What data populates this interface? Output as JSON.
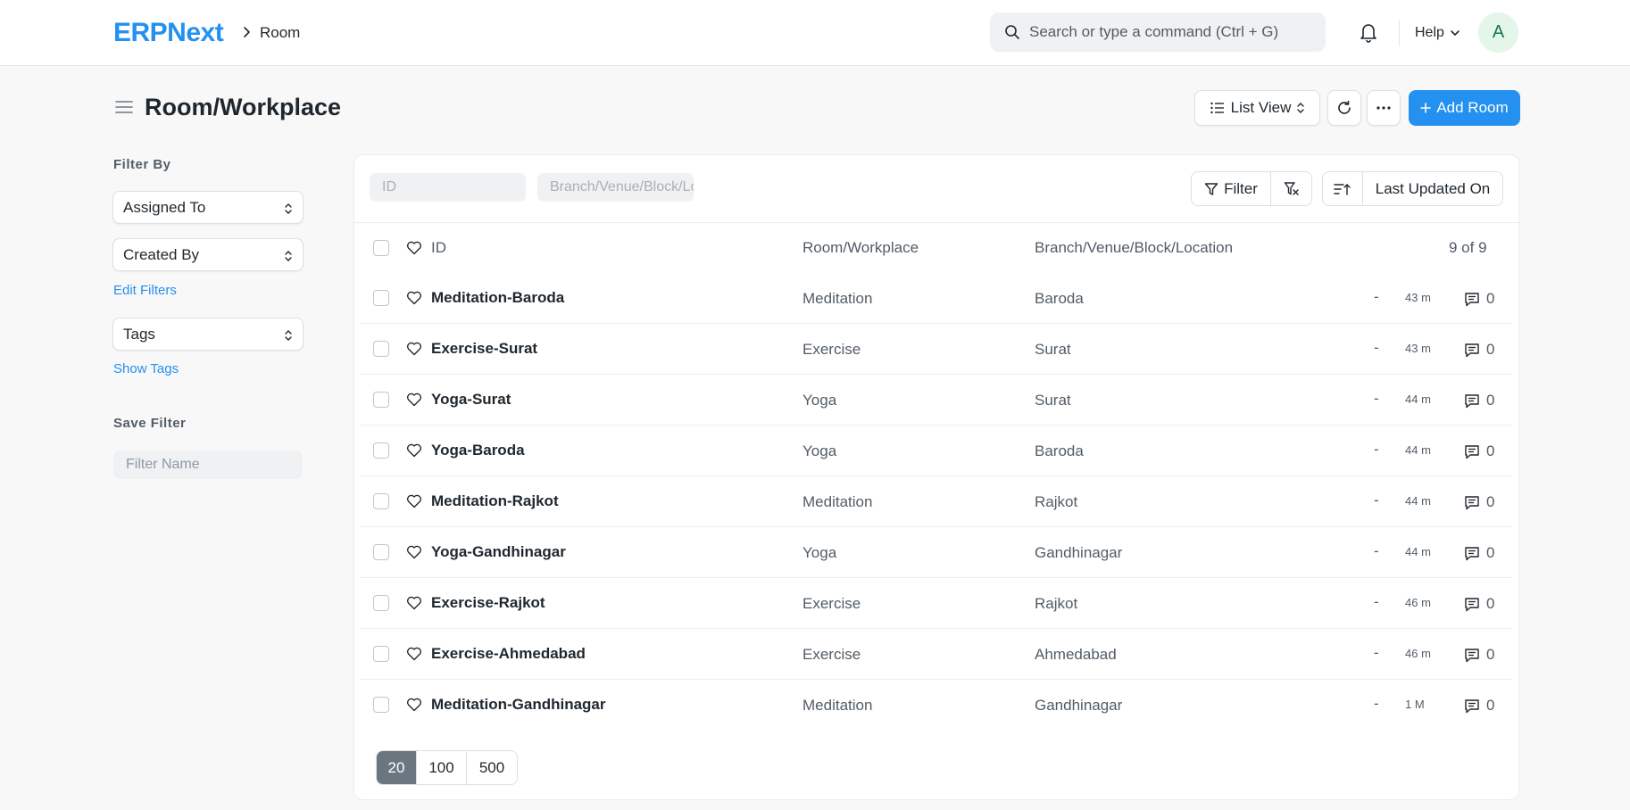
{
  "navbar": {
    "logo": "ERPNext",
    "breadcrumb": "Room",
    "search_placeholder": "Search or type a command (Ctrl + G)",
    "help_label": "Help",
    "avatar_letter": "A"
  },
  "page": {
    "title": "Room/Workplace",
    "list_view_label": "List View",
    "add_button_label": "Add Room",
    "accent_color": "#2490ef"
  },
  "sidebar": {
    "filter_by_heading": "Filter By",
    "assigned_to": "Assigned To",
    "created_by": "Created By",
    "edit_filters": "Edit Filters",
    "tags": "Tags",
    "show_tags": "Show Tags",
    "save_filter_heading": "Save Filter",
    "filter_name_placeholder": "Filter Name"
  },
  "toolbar": {
    "id_placeholder": "ID",
    "branch_placeholder": "Branch/Venue/Block/Location",
    "filter_label": "Filter",
    "sort_label": "Last Updated On"
  },
  "table": {
    "headers": {
      "id": "ID",
      "room": "Room/Workplace",
      "branch": "Branch/Venue/Block/Location",
      "count": "9 of 9"
    },
    "rows": [
      {
        "id": "Meditation-Baroda",
        "room": "Meditation",
        "branch": "Baroda",
        "assigned": "-",
        "modified": "43 m",
        "comments": "0"
      },
      {
        "id": "Exercise-Surat",
        "room": "Exercise",
        "branch": "Surat",
        "assigned": "-",
        "modified": "43 m",
        "comments": "0"
      },
      {
        "id": "Yoga-Surat",
        "room": "Yoga",
        "branch": "Surat",
        "assigned": "-",
        "modified": "44 m",
        "comments": "0"
      },
      {
        "id": "Yoga-Baroda",
        "room": "Yoga",
        "branch": "Baroda",
        "assigned": "-",
        "modified": "44 m",
        "comments": "0"
      },
      {
        "id": "Meditation-Rajkot",
        "room": "Meditation",
        "branch": "Rajkot",
        "assigned": "-",
        "modified": "44 m",
        "comments": "0"
      },
      {
        "id": "Yoga-Gandhinagar",
        "room": "Yoga",
        "branch": "Gandhinagar",
        "assigned": "-",
        "modified": "44 m",
        "comments": "0"
      },
      {
        "id": "Exercise-Rajkot",
        "room": "Exercise",
        "branch": "Rajkot",
        "assigned": "-",
        "modified": "46 m",
        "comments": "0"
      },
      {
        "id": "Exercise-Ahmedabad",
        "room": "Exercise",
        "branch": "Ahmedabad",
        "assigned": "-",
        "modified": "46 m",
        "comments": "0"
      },
      {
        "id": "Meditation-Gandhinagar",
        "room": "Meditation",
        "branch": "Gandhinagar",
        "assigned": "-",
        "modified": "1 M",
        "comments": "0"
      }
    ]
  },
  "paging": {
    "options": [
      "20",
      "100",
      "500"
    ],
    "selected": "20"
  }
}
